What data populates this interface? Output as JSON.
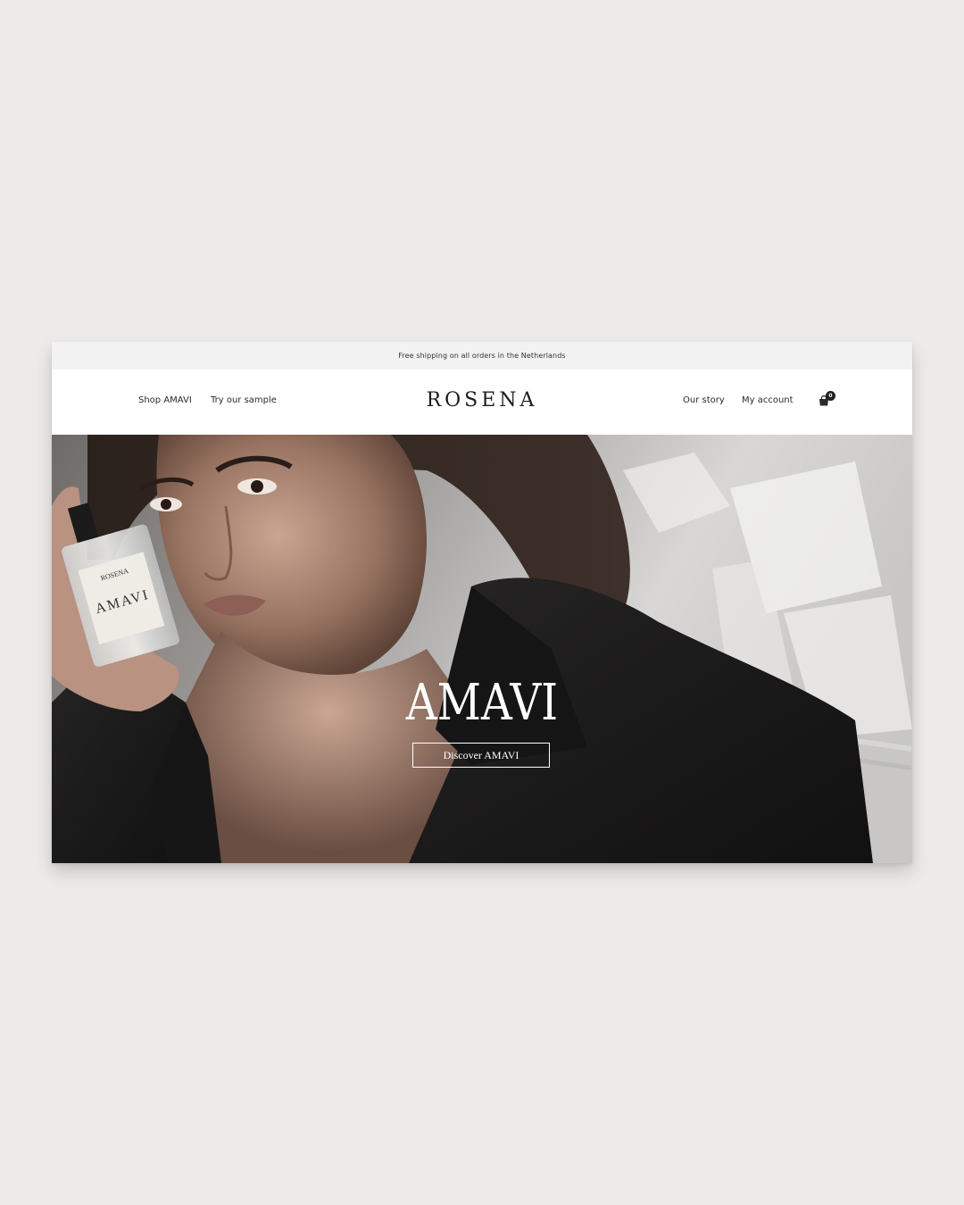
{
  "announcement": {
    "text": "Free shipping on all orders in the Netherlands"
  },
  "header": {
    "logo": "ROSENA",
    "nav_left": [
      "Shop AMAVI",
      "Try our sample"
    ],
    "nav_right": [
      "Our story",
      "My account"
    ],
    "cart": {
      "icon": "shopping-bag-icon",
      "count": "0"
    }
  },
  "hero": {
    "title": "AMAVI",
    "button_label": "Discover AMAVI",
    "image": {
      "subject": "woman-holding-perfume-bottle",
      "bottle_brand": "ROSENA",
      "bottle_name": "AMAVI"
    }
  },
  "colors": {
    "page_background": "#edebe9",
    "announcement_bar": "#f2f2f2",
    "text_dark": "#1c1c1c",
    "hero_text": "#ffffff"
  }
}
